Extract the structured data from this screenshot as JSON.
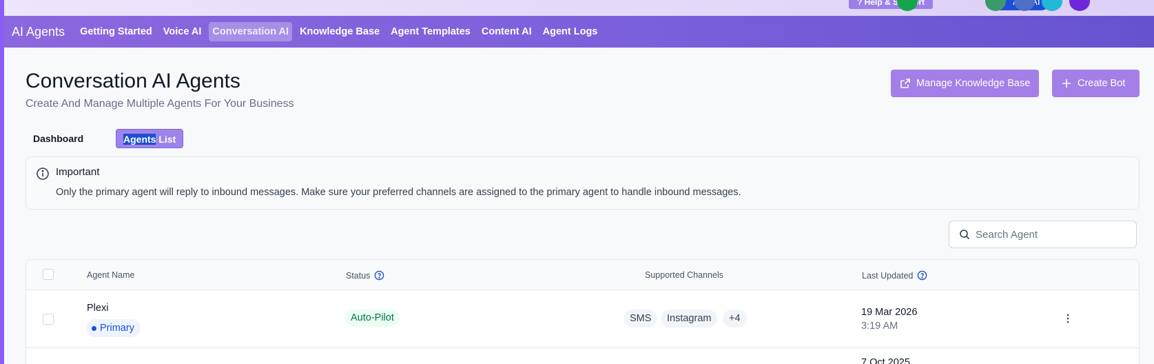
{
  "topbar": {
    "help_label": "? Help & Support",
    "ask_ai_label": "Ask AI"
  },
  "nav": {
    "brand": "AI Agents",
    "items": [
      {
        "label": "Getting Started"
      },
      {
        "label": "Voice AI"
      },
      {
        "label": "Conversation AI",
        "active": true
      },
      {
        "label": "Knowledge Base"
      },
      {
        "label": "Agent Templates"
      },
      {
        "label": "Content AI"
      },
      {
        "label": "Agent Logs"
      }
    ]
  },
  "header": {
    "title": "Conversation AI Agents",
    "subtitle": "Create And Manage Multiple Agents For Your Business",
    "manage_kb_label": "Manage Knowledge Base",
    "create_bot_label": "Create Bot"
  },
  "tabs": {
    "dashboard": "Dashboard",
    "agents_list_selected": "Agents",
    "agents_list_rest": " List"
  },
  "notice": {
    "title": "Important",
    "body": "Only the primary agent will reply to inbound messages. Make sure your preferred channels are assigned to the primary agent to handle inbound messages."
  },
  "search": {
    "placeholder": "Search Agent"
  },
  "table": {
    "columns": {
      "agent_name": "Agent Name",
      "status": "Status",
      "channels": "Supported Channels",
      "last_updated": "Last Updated"
    },
    "rows": [
      {
        "name": "Plexi",
        "badge": "Primary",
        "status": "Auto-Pilot",
        "channels": [
          "SMS",
          "Instagram",
          "+4"
        ],
        "updated_date": "19 Mar 2026",
        "updated_time": "3:19 AM"
      },
      {
        "updated_date": "7 Oct 2025"
      }
    ]
  },
  "colors": {
    "nav_gradient_start": "#8c67de",
    "nav_gradient_end": "#6652cf",
    "button_purple": "#a37fe7",
    "primary_blue": "#1d4ed8",
    "status_green": "#067647"
  }
}
